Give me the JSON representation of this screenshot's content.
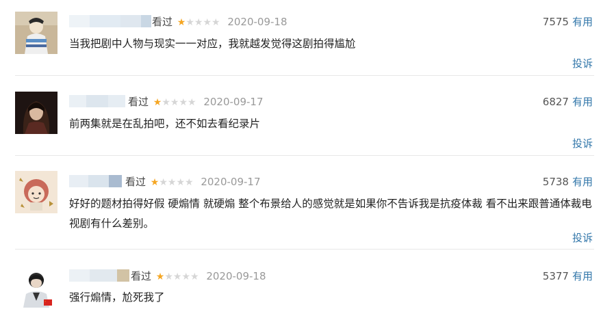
{
  "comments": [
    {
      "status": "看过",
      "rating": 1,
      "max_rating": 5,
      "date": "2020-09-18",
      "votes": "7575",
      "useful_label": "有用",
      "text": "当我把剧中人物与现实一一对应，我就越发觉得这剧拍得尴尬",
      "report_label": "投诉"
    },
    {
      "status": "看过",
      "rating": 1,
      "max_rating": 5,
      "date": "2020-09-17",
      "votes": "6827",
      "useful_label": "有用",
      "text": "前两集就是在乱拍吧，还不如去看纪录片",
      "report_label": "投诉"
    },
    {
      "status": "看过",
      "rating": 1,
      "max_rating": 5,
      "date": "2020-09-17",
      "votes": "5738",
      "useful_label": "有用",
      "text": "好好的题材拍得好假 硬煽情 就硬煽 整个布景给人的感觉就是如果你不告诉我是抗疫体裁 看不出来跟普通体裁电视剧有什么差别。",
      "report_label": "投诉"
    },
    {
      "status": "看过",
      "rating": 1,
      "max_rating": 5,
      "date": "2020-09-18",
      "votes": "5377",
      "useful_label": "有用",
      "text": "强行煽情，尬死我了",
      "report_label": ""
    }
  ],
  "colors": {
    "link": "#3377aa",
    "star_on": "#f5a623",
    "star_off": "#d6d6d6"
  },
  "icons": [
    "user-avatar",
    "star-icon"
  ]
}
